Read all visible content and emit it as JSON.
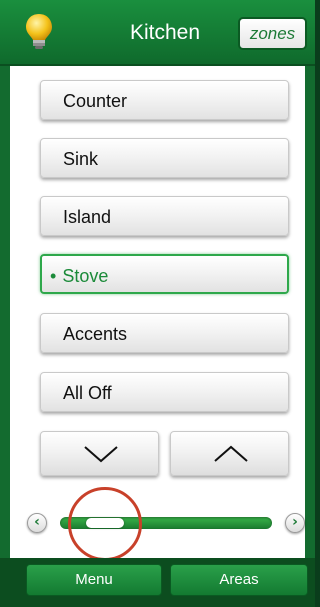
{
  "header": {
    "title": "Kitchen",
    "zones_label": "zones",
    "bulb_icon": "lightbulb-icon"
  },
  "zones": [
    {
      "label": "Counter",
      "selected": false
    },
    {
      "label": "Sink",
      "selected": false
    },
    {
      "label": "Island",
      "selected": false
    },
    {
      "label": "Stove",
      "selected": true
    },
    {
      "label": "Accents",
      "selected": false
    },
    {
      "label": "All Off",
      "selected": false
    }
  ],
  "arrows": {
    "down_icon": "chevron-down-icon",
    "up_icon": "chevron-up-icon"
  },
  "slider": {
    "level_fraction": 0.21,
    "left_icon": "chevron-left-icon",
    "right_icon": "chevron-right-icon"
  },
  "footer": {
    "menu_label": "Menu",
    "areas_label": "Areas"
  },
  "colors": {
    "brand_green": "#1a8f3e",
    "selected_green": "#2ea84b",
    "highlight_ring": "#c8412a"
  }
}
